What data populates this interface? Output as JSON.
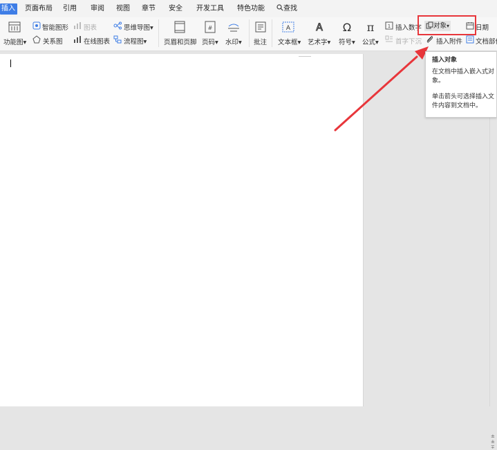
{
  "menubar": {
    "tabs": [
      {
        "label": "插入"
      },
      {
        "label": "页面布局"
      },
      {
        "label": "引用"
      },
      {
        "label": "审阅"
      },
      {
        "label": "视图"
      },
      {
        "label": "章节"
      },
      {
        "label": "安全"
      },
      {
        "label": "开发工具"
      },
      {
        "label": "特色功能"
      }
    ],
    "search_label": "查找"
  },
  "ribbon": {
    "functional_chart": "功能图",
    "smart_graphic": "智能图形",
    "chart": "图表",
    "mind_map": "思维导图",
    "relation_graph": "关系图",
    "online_chart": "在线图表",
    "flowchart": "流程图",
    "header_footer": "页眉和页脚",
    "page_number": "页码",
    "watermark": "水印",
    "comment": "批注",
    "text_box": "文本框",
    "word_art": "艺术字",
    "symbol": "符号",
    "formula": "公式",
    "insert_number": "插入数字",
    "drop_cap": "首字下沉",
    "object": "对象",
    "insert_attachment": "插入附件",
    "date": "日期",
    "doc_parts": "文档部件"
  },
  "tooltip": {
    "title": "插入对象",
    "line1": "在文档中插入嵌入式对象。",
    "line2": "单击箭头可选择插入文件内容到文档中。"
  },
  "colors": {
    "accent": "#3e7de6",
    "highlight": "#e8363b"
  }
}
